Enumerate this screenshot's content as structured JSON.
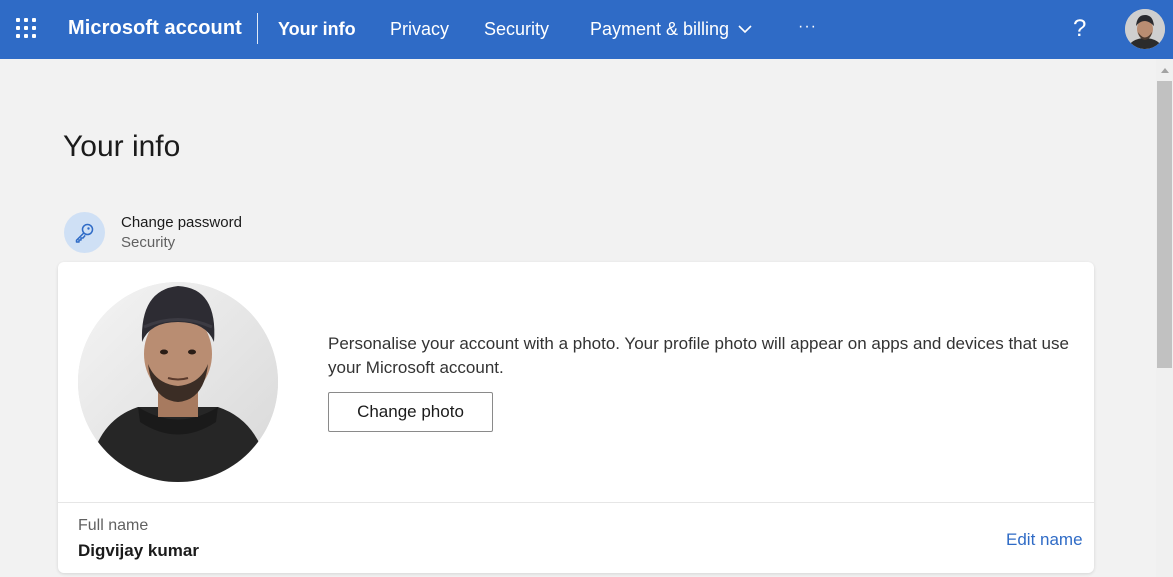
{
  "header": {
    "brand": "Microsoft account",
    "nav": [
      {
        "label": "Your info",
        "active": true
      },
      {
        "label": "Privacy",
        "active": false
      },
      {
        "label": "Security",
        "active": false
      },
      {
        "label": "Payment & billing",
        "active": false
      }
    ],
    "more_label": "···",
    "help_label": "?",
    "icons": [
      "app-launcher-icon",
      "chevron-down-icon",
      "help-icon",
      "avatar"
    ]
  },
  "page": {
    "title": "Your info"
  },
  "password_shortcut": {
    "title": "Change password",
    "subtitle": "Security",
    "icon": "key-icon"
  },
  "profile_card": {
    "photo_description": "Personalise your account with a photo. Your profile photo will appear on apps and devices that use your Microsoft account.",
    "change_photo_label": "Change photo",
    "full_name_label": "Full name",
    "full_name_value": "Digvijay kumar",
    "edit_name_label": "Edit name"
  },
  "colors": {
    "header_bg": "#2f6bc6",
    "page_bg": "#f2f2f2",
    "link": "#2f6bc6",
    "icon_bubble": "#cfe0f5"
  }
}
